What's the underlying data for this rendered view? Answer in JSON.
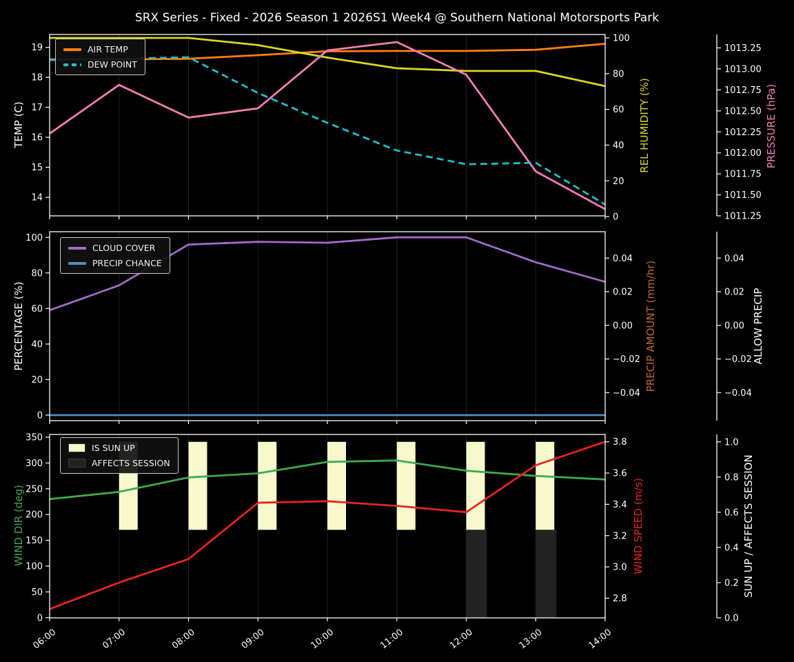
{
  "figure": {
    "title": "SRX Series - Fixed - 2026 Season 1 2026S1 Week4 @ Southern National Motorsports Park",
    "background": "#000000",
    "text_color": "#ffffff",
    "gridline_color": "rgba(255,255,255,0.13)"
  },
  "x_axis": {
    "hours": [
      6,
      7,
      8,
      9,
      10,
      11,
      12,
      13,
      14
    ],
    "labels": [
      "06:00",
      "07:00",
      "08:00",
      "09:00",
      "10:00",
      "11:00",
      "12:00",
      "13:00",
      "14:00"
    ],
    "rotation_deg": 38
  },
  "chart_data": [
    {
      "type": "line",
      "box": {
        "y0": 50,
        "y1": 313
      },
      "axes": {
        "left": {
          "label": "TEMP (C)",
          "color": "#ffffff",
          "min": 13.38,
          "max": 19.43,
          "ticks": [
            {
              "v": 19,
              "t": "19"
            },
            {
              "v": 18,
              "t": "18"
            },
            {
              "v": 17,
              "t": "17"
            },
            {
              "v": 16,
              "t": "16"
            },
            {
              "v": 15,
              "t": "15"
            },
            {
              "v": 14,
              "t": "14"
            }
          ]
        },
        "right1": {
          "label": "REL HUMIDITY (%)",
          "color": "#d8da20",
          "min": 0.39,
          "max": 101.93,
          "ticks": [
            {
              "v": 100,
              "t": "100"
            },
            {
              "v": 80,
              "t": "80"
            },
            {
              "v": 60,
              "t": "60"
            },
            {
              "v": 40,
              "t": "40"
            },
            {
              "v": 20,
              "t": "20"
            },
            {
              "v": 0,
              "t": "0"
            }
          ]
        },
        "right2": {
          "label": "PRESSURE (hPa)",
          "color": "#f47eb9",
          "min": 1011.25,
          "max": 1013.41,
          "ticks": [
            {
              "v": 1013.25,
              "t": "1013.25"
            },
            {
              "v": 1013.0,
              "t": "1013.00"
            },
            {
              "v": 1012.75,
              "t": "1012.75"
            },
            {
              "v": 1012.5,
              "t": "1012.50"
            },
            {
              "v": 1012.25,
              "t": "1012.25"
            },
            {
              "v": 1012.0,
              "t": "1012.00"
            },
            {
              "v": 1011.75,
              "t": "1011.75"
            },
            {
              "v": 1011.5,
              "t": "1011.50"
            },
            {
              "v": 1011.25,
              "t": "1011.25"
            }
          ]
        }
      },
      "legend": {
        "items": [
          {
            "label": "AIR TEMP",
            "color": "#ff7f0e",
            "dash": false
          },
          {
            "label": "DEW POINT",
            "color": "#22bec8",
            "dash": true
          }
        ]
      },
      "series": [
        {
          "name": "AIR TEMP",
          "axis": "left",
          "color": "#ff7f0e",
          "dash": false,
          "values": [
            18.6,
            18.6,
            18.62,
            18.74,
            18.87,
            18.88,
            18.88,
            18.92,
            19.12
          ]
        },
        {
          "name": "REL HUMIDITY",
          "axis": "right1",
          "color": "#d8da20",
          "dash": false,
          "values": [
            100,
            100,
            100,
            96,
            89,
            83,
            81.5,
            81.5,
            73
          ]
        },
        {
          "name": "PRESSURE",
          "axis": "right2",
          "color": "#f47eb9",
          "dash": false,
          "values": [
            1012.23,
            1012.81,
            1012.42,
            1012.53,
            1013.22,
            1013.32,
            1012.93,
            1011.78,
            1011.33
          ]
        },
        {
          "name": "DEW POINT",
          "axis": "left",
          "color": "#22bec8",
          "dash": true,
          "values": [
            18.58,
            18.62,
            18.67,
            17.48,
            16.48,
            15.56,
            15.1,
            15.15,
            13.76
          ]
        }
      ]
    },
    {
      "type": "line",
      "box": {
        "y0": 336,
        "y1": 610
      },
      "axes": {
        "left": {
          "label": "PERCENTAGE (%)",
          "color": "#ffffff",
          "min": -3.1,
          "max": 103.2,
          "ticks": [
            {
              "v": 100,
              "t": "100"
            },
            {
              "v": 80,
              "t": "80"
            },
            {
              "v": 60,
              "t": "60"
            },
            {
              "v": 40,
              "t": "40"
            },
            {
              "v": 20,
              "t": "20"
            },
            {
              "v": 0,
              "t": "0"
            }
          ]
        },
        "right1": {
          "label": "PRECIP AMOUNT (mm/hr)",
          "color": "#c06a32",
          "min": -0.0567,
          "max": 0.0557,
          "ticks": [
            {
              "v": 0.04,
              "t": "0.04"
            },
            {
              "v": 0.02,
              "t": "0.02"
            },
            {
              "v": 0,
              "t": "0.00"
            },
            {
              "v": -0.02,
              "t": "−0.02"
            },
            {
              "v": -0.04,
              "t": "−0.04"
            }
          ]
        },
        "right2": {
          "label": "ALLOW PRECIP",
          "color": "#ffffff",
          "min": -0.0567,
          "max": 0.0557,
          "ticks": [
            {
              "v": 0.04,
              "t": "0.04"
            },
            {
              "v": 0.02,
              "t": "0.02"
            },
            {
              "v": 0,
              "t": "0.00"
            },
            {
              "v": -0.02,
              "t": "−0.02"
            },
            {
              "v": -0.04,
              "t": "−0.04"
            }
          ]
        }
      },
      "legend": {
        "items": [
          {
            "label": "CLOUD COVER",
            "color": "#a26cc6",
            "dash": false
          },
          {
            "label": "PRECIP CHANCE",
            "color": "#4e8fc7",
            "dash": false
          }
        ]
      },
      "series": [
        {
          "name": "CLOUD COVER",
          "axis": "left",
          "color": "#a26cc6",
          "dash": false,
          "values": [
            59,
            73,
            96,
            97.5,
            97,
            100,
            100,
            86,
            75
          ]
        },
        {
          "name": "PRECIP CHANCE",
          "axis": "left",
          "color": "#4e8fc7",
          "dash": false,
          "values": [
            0,
            0,
            0,
            0,
            0,
            0,
            0,
            0,
            0
          ]
        }
      ],
      "precip_amount_mm_hr": [
        0,
        0,
        0,
        0,
        0,
        0,
        0,
        0,
        0
      ]
    },
    {
      "type": "line+bar",
      "box": {
        "y0": 630,
        "y1": 896
      },
      "axes": {
        "left": {
          "label": "WIND DIR (deg)",
          "color": "#3ea94f",
          "min": -0.4,
          "max": 355.4,
          "ticks": [
            {
              "v": 350,
              "t": "350"
            },
            {
              "v": 300,
              "t": "300"
            },
            {
              "v": 250,
              "t": "250"
            },
            {
              "v": 200,
              "t": "200"
            },
            {
              "v": 150,
              "t": "150"
            },
            {
              "v": 100,
              "t": "100"
            },
            {
              "v": 50,
              "t": "50"
            },
            {
              "v": 0,
              "t": "0"
            }
          ]
        },
        "right1": {
          "label": "WIND SPEED (m/s)",
          "color": "#e52420",
          "min": 2.674,
          "max": 3.847,
          "ticks": [
            {
              "v": 3.8,
              "t": "3.8"
            },
            {
              "v": 3.6,
              "t": "3.6"
            },
            {
              "v": 3.4,
              "t": "3.4"
            },
            {
              "v": 3.2,
              "t": "3.2"
            },
            {
              "v": 3.0,
              "t": "3.0"
            },
            {
              "v": 2.8,
              "t": "2.8"
            }
          ]
        },
        "right2": {
          "label": "SUN UP / AFFECTS SESSION",
          "color": "#ffffff",
          "min": 0,
          "max": 1.042,
          "ticks": [
            {
              "v": 1.0,
              "t": "1.0"
            },
            {
              "v": 0.8,
              "t": "0.8"
            },
            {
              "v": 0.6,
              "t": "0.6"
            },
            {
              "v": 0.4,
              "t": "0.4"
            },
            {
              "v": 0.2,
              "t": "0.2"
            },
            {
              "v": 0.0,
              "t": "0.0"
            }
          ]
        }
      },
      "legend": {
        "items": [
          {
            "label": "IS SUN UP",
            "color": "#f8f8cd",
            "swatch": true
          },
          {
            "label": "AFFECTS SESSION",
            "color": "#222222",
            "swatch": true
          }
        ]
      },
      "bars": [
        {
          "name": "IS SUN UP",
          "axis": "right2",
          "color": "#f8f8cd",
          "from": 0.5,
          "to": 1.0,
          "width": 27,
          "flags": [
            false,
            true,
            true,
            true,
            true,
            true,
            true,
            true,
            false
          ]
        },
        {
          "name": "AFFECTS SESSION",
          "axis": "right2",
          "color": "#222222",
          "from": 0.0,
          "to": 0.5,
          "width": 30,
          "flags": [
            false,
            false,
            false,
            false,
            false,
            false,
            true,
            true,
            false
          ]
        }
      ],
      "series": [
        {
          "name": "WIND DIR",
          "axis": "left",
          "color": "#3ea94f",
          "dash": false,
          "values": [
            230,
            244,
            272,
            280,
            302,
            305,
            285,
            275,
            268
          ]
        },
        {
          "name": "WIND SPEED",
          "axis": "right1",
          "color": "#e52420",
          "dash": false,
          "values": [
            2.73,
            2.9,
            3.05,
            3.41,
            3.42,
            3.39,
            3.35,
            3.65,
            3.8
          ]
        }
      ]
    }
  ]
}
